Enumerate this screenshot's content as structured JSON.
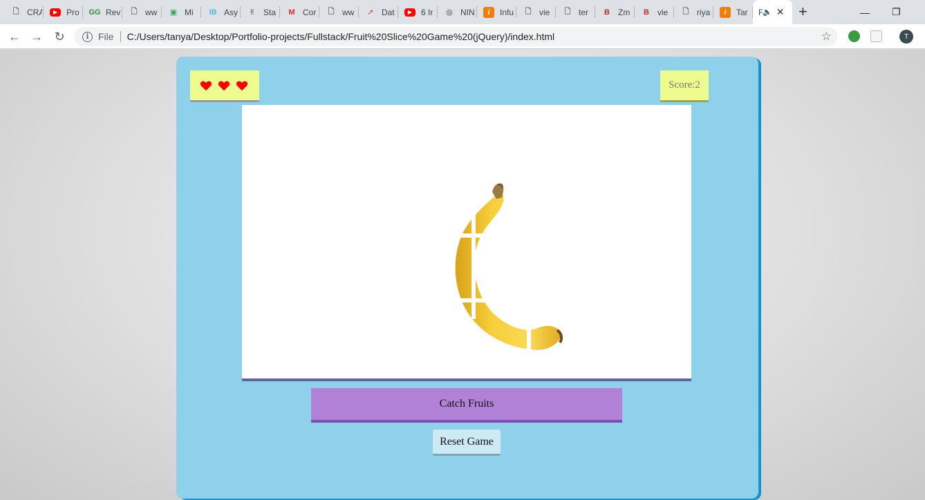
{
  "browser": {
    "tabs": [
      {
        "label": "CRA",
        "icon": "doc-icon",
        "color": "#5f6368"
      },
      {
        "label": "Pro",
        "icon": "youtube-icon",
        "color": "#ff0000"
      },
      {
        "label": "Rev",
        "icon": "gfg-icon",
        "color": "#2f8d46"
      },
      {
        "label": "ww",
        "icon": "doc-icon",
        "color": "#5f6368"
      },
      {
        "label": "Mi",
        "icon": "green-box-icon",
        "color": "#34a853"
      },
      {
        "label": "Asy",
        "icon": "ib-icon",
        "color": "#56b4d3"
      },
      {
        "label": "Sta",
        "icon": "peace-hand-icon",
        "color": "#333333"
      },
      {
        "label": "Cor",
        "icon": "gmail-icon",
        "color": "#d93025"
      },
      {
        "label": "ww",
        "icon": "doc-icon",
        "color": "#5f6368"
      },
      {
        "label": "Dat",
        "icon": "red-arrow-icon",
        "color": "#e53935"
      },
      {
        "label": "6 Ir",
        "icon": "youtube-icon",
        "color": "#ff0000"
      },
      {
        "label": "NIN",
        "icon": "globe-icon",
        "color": "#333333"
      },
      {
        "label": "Infu",
        "icon": "orange-i-icon",
        "color": "#f57c00"
      },
      {
        "label": "vie",
        "icon": "doc-icon",
        "color": "#5f6368"
      },
      {
        "label": "ter",
        "icon": "doc-icon",
        "color": "#5f6368"
      },
      {
        "label": "Zm",
        "icon": "b-icon",
        "color": "#c62828"
      },
      {
        "label": "vie",
        "icon": "b-icon",
        "color": "#c62828"
      },
      {
        "label": "riya",
        "icon": "doc-icon",
        "color": "#5f6368"
      },
      {
        "label": "Tar",
        "icon": "orange-i-icon",
        "color": "#f57c00"
      }
    ],
    "active_tab": {
      "label": "F",
      "close": "✕"
    },
    "new_tab": "+",
    "url_scheme": "File",
    "url": "C:/Users/tanya/Desktop/Portfolio-projects/Fullstack/Fruit%20Slice%20Game%20(jQuery)/index.html",
    "profile_initial": "T"
  },
  "game": {
    "lives": 3,
    "score_label": "Score:2",
    "fruit": "banana",
    "catch_label": "Catch Fruits",
    "reset_label": "Reset Game",
    "colors": {
      "container": "#8fd0ea",
      "panel": "#eefc8f",
      "heart": "#ff0000",
      "catch_button": "#b081d6",
      "reset_button": "#cdeaf4"
    }
  }
}
